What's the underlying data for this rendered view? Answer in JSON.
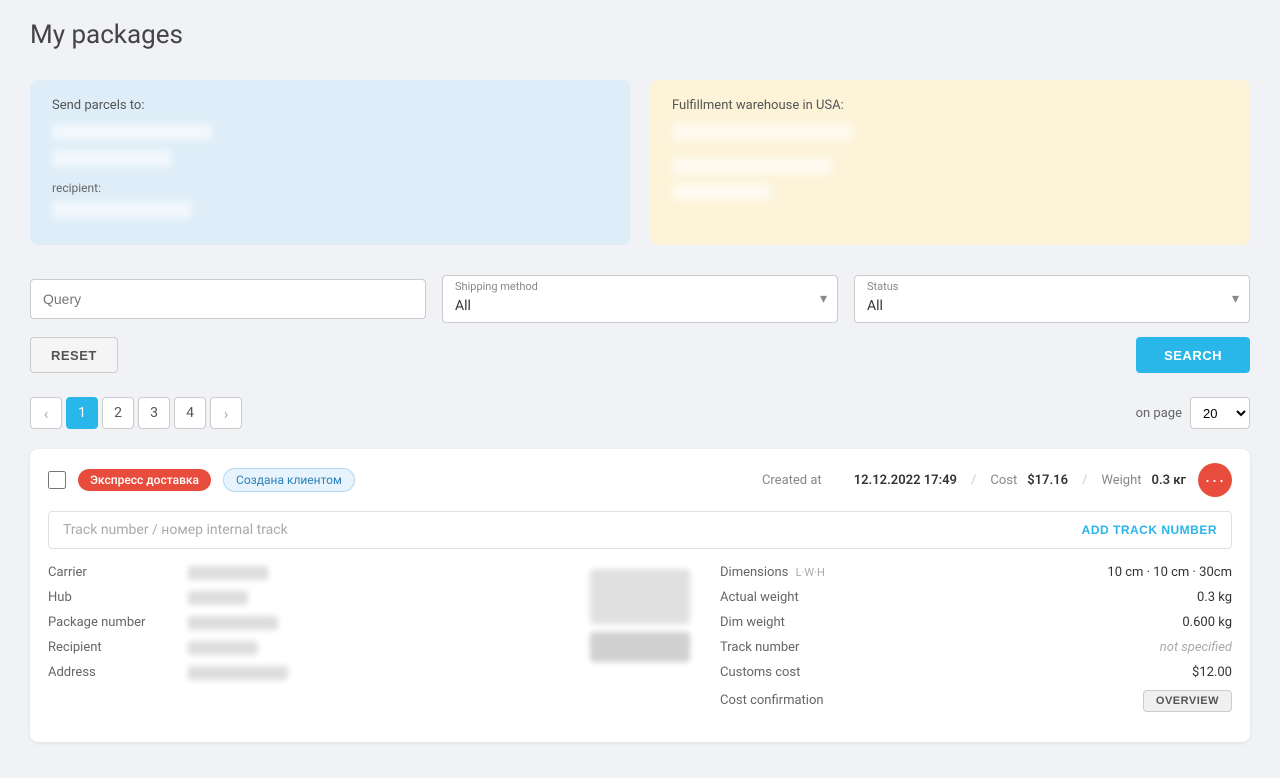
{
  "page": {
    "title": "My packages"
  },
  "info_cards": {
    "send_parcels": {
      "label": "Send parcels to:"
    },
    "fulfillment": {
      "label": "Fulfillment warehouse in USA:"
    }
  },
  "filters": {
    "query_placeholder": "Query",
    "shipping_method_label": "Shipping method",
    "shipping_method_value": "All",
    "status_label": "Status",
    "status_value": "All",
    "reset_label": "RESET",
    "search_label": "SEARCH"
  },
  "pagination": {
    "on_page_label": "on page",
    "pages": [
      "1",
      "2",
      "3",
      "4"
    ],
    "active_page": "1",
    "per_page_value": "20"
  },
  "package": {
    "badge_express": "Экспресс доставка",
    "badge_status": "Создана клиентом",
    "created_label": "Created at",
    "created_date": "12.12.2022 17:49",
    "cost_label": "Cost",
    "cost_value": "$17.16",
    "weight_label": "Weight",
    "weight_value": "0.3 кг",
    "track_placeholder": "Track number / номер internal track",
    "add_track_label": "ADD TRACK NUMBER",
    "details_left": {
      "carrier_label": "Carrier",
      "hub_label": "Hub",
      "package_number_label": "Package number",
      "recipient_label": "Recipient",
      "address_label": "Address"
    },
    "details_right": {
      "dimensions_label": "Dimensions",
      "dimensions_sub": "L·W·H",
      "dimensions_value": "10 cm · 10 cm · 30cm",
      "actual_weight_label": "Actual weight",
      "actual_weight_value": "0.3 kg",
      "dim_weight_label": "Dim weight",
      "dim_weight_value": "0.600 kg",
      "track_number_label": "Track number",
      "track_number_value": "not specified",
      "customs_cost_label": "Customs cost",
      "customs_cost_value": "$12.00",
      "cost_confirmation_label": "Cost confirmation",
      "overview_btn": "OVERVIEW"
    }
  }
}
